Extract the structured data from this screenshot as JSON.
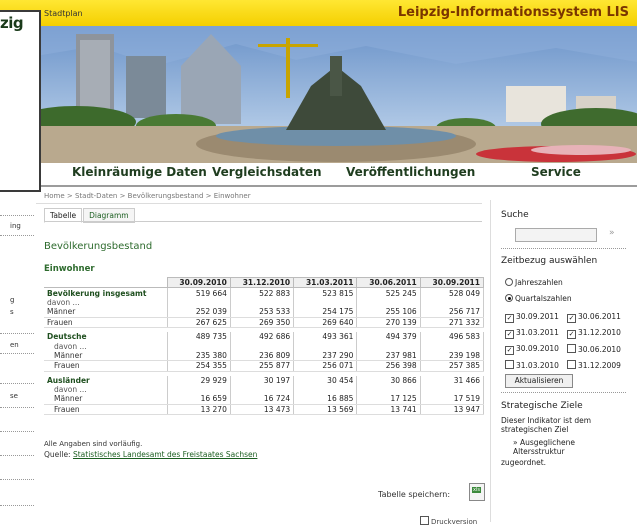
{
  "header": {
    "logo_fragment": "zig",
    "stadtplan": "Stadtplan",
    "title": "Leipzig-Informationssystem LIS"
  },
  "nav": [
    "Kleinräumige Daten",
    "Vergleichsdaten",
    "Veröffentlichungen",
    "Service"
  ],
  "breadcrumb": "Home > Stadt-Daten > Bevölkerungsbestand > Einwohner",
  "left_sidebar": [
    "ing",
    "g",
    "s",
    "en",
    "se"
  ],
  "tabs": [
    "Tabelle",
    "Diagramm"
  ],
  "page_title": "Bevölkerungsbestand",
  "subtitle": "Einwohner",
  "table": {
    "headers": [
      "30.09.2010",
      "31.12.2010",
      "31.03.2011",
      "30.06.2011",
      "30.09.2011"
    ],
    "davon": "davon ...",
    "groups": [
      {
        "label": "Bevölkerung insgesamt",
        "values": [
          "519 664",
          "522 883",
          "523 815",
          "525 245",
          "528 049"
        ],
        "rows": [
          {
            "label": "Männer",
            "values": [
              "252 039",
              "253 533",
              "254 175",
              "255 106",
              "256 717"
            ]
          },
          {
            "label": "Frauen",
            "values": [
              "267 625",
              "269 350",
              "269 640",
              "270 139",
              "271 332"
            ]
          }
        ]
      },
      {
        "label": "Deutsche",
        "values": [
          "489 735",
          "492 686",
          "493 361",
          "494 379",
          "496 583"
        ],
        "rows": [
          {
            "label": "Männer",
            "values": [
              "235 380",
              "236 809",
              "237 290",
              "237 981",
              "239 198"
            ]
          },
          {
            "label": "Frauen",
            "values": [
              "254 355",
              "255 877",
              "256 071",
              "256 398",
              "257 385"
            ]
          }
        ]
      },
      {
        "label": "Ausländer",
        "values": [
          "29 929",
          "30 197",
          "30 454",
          "30 866",
          "31 466"
        ],
        "rows": [
          {
            "label": "Männer",
            "values": [
              "16 659",
              "16 724",
              "16 885",
              "17 125",
              "17 519"
            ]
          },
          {
            "label": "Frauen",
            "values": [
              "13 270",
              "13 473",
              "13 569",
              "13 741",
              "13 947"
            ]
          }
        ]
      }
    ]
  },
  "notes": {
    "provisional": "Alle Angaben sind vorläufig.",
    "source_label": "Quelle:",
    "source_link": "Statistisches Landesamt des Freistaates Sachsen"
  },
  "save_label": "Tabelle speichern:",
  "save_icon_label": "xls",
  "print_label": "Druckversion",
  "right": {
    "search_heading": "Suche",
    "search_go": "»",
    "time_heading": "Zeitbezug auswählen",
    "radio": [
      {
        "label": "Jahreszahlen",
        "checked": false
      },
      {
        "label": "Quartalszahlen",
        "checked": true
      }
    ],
    "checks": [
      [
        {
          "label": "30.09.2011",
          "checked": true
        },
        {
          "label": "30.06.2011",
          "checked": true
        }
      ],
      [
        {
          "label": "31.03.2011",
          "checked": true
        },
        {
          "label": "31.12.2010",
          "checked": true
        }
      ],
      [
        {
          "label": "30.09.2010",
          "checked": true
        },
        {
          "label": "30.06.2010",
          "checked": false
        }
      ],
      [
        {
          "label": "31.03.2010",
          "checked": false
        },
        {
          "label": "31.12.2009",
          "checked": false
        }
      ]
    ],
    "update_button": "Aktualisieren",
    "goals_heading": "Strategische Ziele",
    "goals_text": "Dieser Indikator ist dem strategischen Ziel",
    "goals_item": "Ausgeglichene Altersstruktur",
    "goals_end": "zugeordnet."
  }
}
